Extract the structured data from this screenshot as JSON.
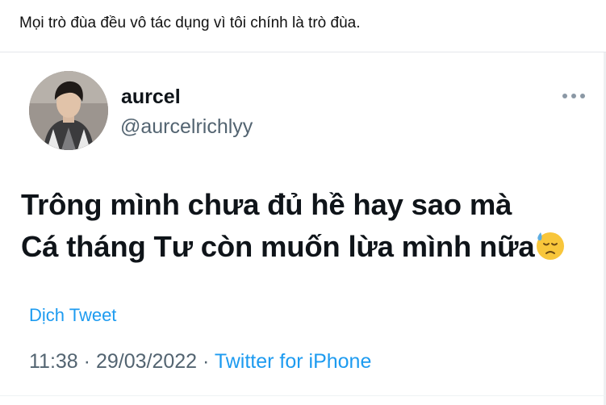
{
  "post": {
    "caption": "Mọi trò đùa đều vô tác dụng vì tôi chính là trò đùa."
  },
  "tweet": {
    "display_name": "aurcel",
    "handle": "@aurcelrichlyy",
    "text_line_1": "Trông mình chưa đủ hề hay sao mà",
    "text_line_2": "Cá tháng Tư còn muốn lừa mình nữa",
    "emoji": "downcast-face-with-sweat",
    "translate_label": "Dịch Tweet",
    "time": "11:38",
    "separator_1": " · ",
    "date": "29/03/2022",
    "separator_2": " · ",
    "source": "Twitter for iPhone",
    "more_icon": "more-horizontal-icon"
  },
  "colors": {
    "link": "#1d9bf0",
    "secondary_text": "#536471",
    "primary_text": "#0f1419"
  }
}
